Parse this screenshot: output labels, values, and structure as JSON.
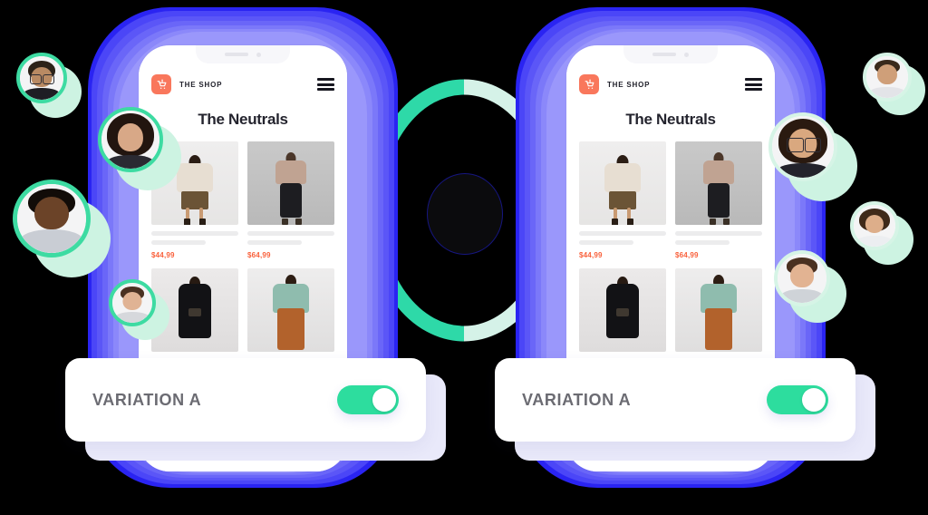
{
  "scene": {
    "background_color": "#000000",
    "accent_purple": "#5b56f7",
    "accent_green": "#2ddd9e",
    "accent_mint": "#cdf3e2",
    "accent_coral": "#f9775c"
  },
  "center": {
    "ring_left_color": "#2ed9a8",
    "ring_right_color": "#d5f2e8",
    "dot_color": "#0b0b0d"
  },
  "phones": [
    {
      "id": "variation-a-left",
      "header": {
        "cart_icon": "shopping-cart-icon",
        "brand": "THE SHOP",
        "menu_icon": "hamburger-menu-icon"
      },
      "collection_title": "The Neutrals",
      "products": [
        {
          "price": "$44,99",
          "name_placeholder": "",
          "image": "model-hoodie-skirt"
        },
        {
          "price": "$64,99",
          "name_placeholder": "",
          "image": "model-tee-trousers"
        },
        {
          "price": "",
          "name_placeholder": "",
          "image": "model-black-dress"
        },
        {
          "price": "",
          "name_placeholder": "",
          "image": "model-green-top-skirt"
        }
      ]
    },
    {
      "id": "variation-a-right",
      "header": {
        "cart_icon": "shopping-cart-icon",
        "brand": "THE SHOP",
        "menu_icon": "hamburger-menu-icon"
      },
      "collection_title": "The Neutrals",
      "products": [
        {
          "price": "$44,99",
          "name_placeholder": "",
          "image": "model-hoodie-skirt"
        },
        {
          "price": "$64,99",
          "name_placeholder": "",
          "image": "model-tee-trousers"
        },
        {
          "price": "",
          "name_placeholder": "",
          "image": "model-black-dress"
        },
        {
          "price": "",
          "name_placeholder": "",
          "image": "model-green-top-skirt"
        }
      ]
    }
  ],
  "variation_cards": [
    {
      "label": "VARIATION A",
      "toggle_state": "on"
    },
    {
      "label": "VARIATION A",
      "toggle_state": "on"
    }
  ],
  "avatars": [
    {
      "id": "avatar-left-1",
      "ring": "green",
      "hair": "#2c2218",
      "skin": "#b98a63",
      "glasses": true,
      "shirt": "#1e1e24"
    },
    {
      "id": "avatar-left-2",
      "ring": "green",
      "hair": "#22150f",
      "skin": "#d8a887",
      "glasses": false,
      "shirt": "#2a2a32"
    },
    {
      "id": "avatar-left-3",
      "ring": "green",
      "hair": "#120c08",
      "skin": "#6b4328",
      "glasses": false,
      "shirt": "#c9cdd4"
    },
    {
      "id": "avatar-left-4",
      "ring": "green",
      "hair": "#4a3122",
      "skin": "#e0b394",
      "glasses": false,
      "shirt": "#d6d8dc"
    },
    {
      "id": "avatar-right-1",
      "ring": "mint",
      "hair": "#3a2a1c",
      "skin": "#cf9f79",
      "glasses": false,
      "shirt": "#e3e4e8"
    },
    {
      "id": "avatar-right-2",
      "ring": "mint",
      "hair": "#2a1a10",
      "skin": "#d9a87f",
      "glasses": true,
      "shirt": "#23232b"
    },
    {
      "id": "avatar-right-3",
      "ring": "mint",
      "hair": "#3f2a1a",
      "skin": "#ddae8a",
      "glasses": false,
      "shirt": "#eceef1"
    },
    {
      "id": "avatar-right-4",
      "ring": "mint",
      "hair": "#4a3020",
      "skin": "#e2b392",
      "glasses": false,
      "shirt": "#cfd3d8"
    }
  ]
}
